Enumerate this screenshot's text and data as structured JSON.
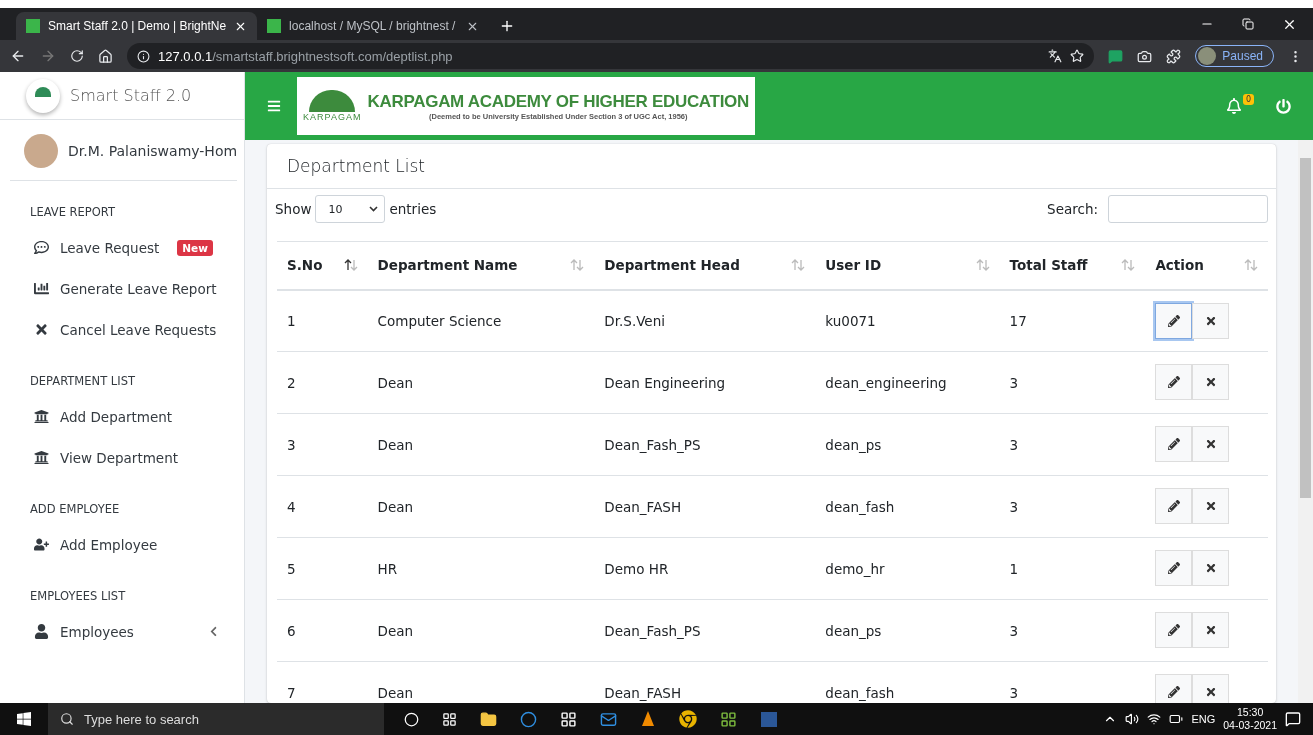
{
  "browser": {
    "tabs": [
      {
        "title": "Smart Staff 2.0 | Demo | BrightNe",
        "selected": true
      },
      {
        "title": "localhost / MySQL / brightnest /",
        "selected": false
      }
    ],
    "address": {
      "host": "127.0.0.1",
      "path": "/smartstaff.brightnestsoft.com/deptlist.php"
    },
    "profile": "Paused"
  },
  "sidebar": {
    "brand": "Smart Staff 2.0",
    "user": "Dr.M. Palaniswamy-Hom",
    "sections": [
      {
        "heading": "LEAVE REPORT",
        "items": [
          {
            "label": "Leave Request",
            "badge": "New"
          },
          {
            "label": "Generate Leave Report"
          },
          {
            "label": "Cancel Leave Requests"
          }
        ]
      },
      {
        "heading": "DEPARTMENT LIST",
        "items": [
          {
            "label": "Add Department"
          },
          {
            "label": "View Department"
          }
        ]
      },
      {
        "heading": "ADD EMPLOYEE",
        "items": [
          {
            "label": "Add Employee"
          }
        ]
      },
      {
        "heading": "EMPLOYEES LIST",
        "items": [
          {
            "label": "Employees",
            "expanded": false
          }
        ]
      }
    ]
  },
  "header": {
    "logo_small": "KARPAGAM",
    "title": "KARPAGAM ACADEMY OF HIGHER EDUCATION",
    "subtitle": "(Deemed to be University Established Under Section 3 of UGC Act, 1956)",
    "notification_count": "0"
  },
  "card": {
    "title": "Department List",
    "show_label": "Show",
    "page_size": "10",
    "entries_label": "entries",
    "search_label": "Search:",
    "columns": [
      {
        "label": "S.No",
        "sorted": true
      },
      {
        "label": "Department Name",
        "sorted": false
      },
      {
        "label": "Department Head",
        "sorted": false
      },
      {
        "label": "User ID",
        "sorted": false
      },
      {
        "label": "Total Staff",
        "sorted": false
      },
      {
        "label": "Action",
        "sorted": false
      }
    ],
    "rows": [
      {
        "cells": [
          "1",
          "Computer Science",
          "Dr.S.Veni",
          "ku0071",
          "17"
        ],
        "edit_focused": true
      },
      {
        "cells": [
          "2",
          "Dean",
          "Dean Engineering",
          "dean_engineering",
          "3"
        ],
        "edit_focused": false
      },
      {
        "cells": [
          "3",
          "Dean",
          "Dean_Fash_PS",
          "dean_ps",
          "3"
        ],
        "edit_focused": false
      },
      {
        "cells": [
          "4",
          "Dean",
          "Dean_FASH",
          "dean_fash",
          "3"
        ],
        "edit_focused": false
      },
      {
        "cells": [
          "5",
          "HR",
          "Demo HR",
          "demo_hr",
          "1"
        ],
        "edit_focused": false
      },
      {
        "cells": [
          "6",
          "Dean",
          "Dean_Fash_PS",
          "dean_ps",
          "3"
        ],
        "edit_focused": false
      },
      {
        "cells": [
          "7",
          "Dean",
          "Dean_FASH",
          "dean_fash",
          "3"
        ],
        "edit_focused": false
      }
    ]
  },
  "taskbar": {
    "search_placeholder": "Type here to search",
    "language": "ENG",
    "time": "15:30",
    "date": "04-03-2021"
  }
}
